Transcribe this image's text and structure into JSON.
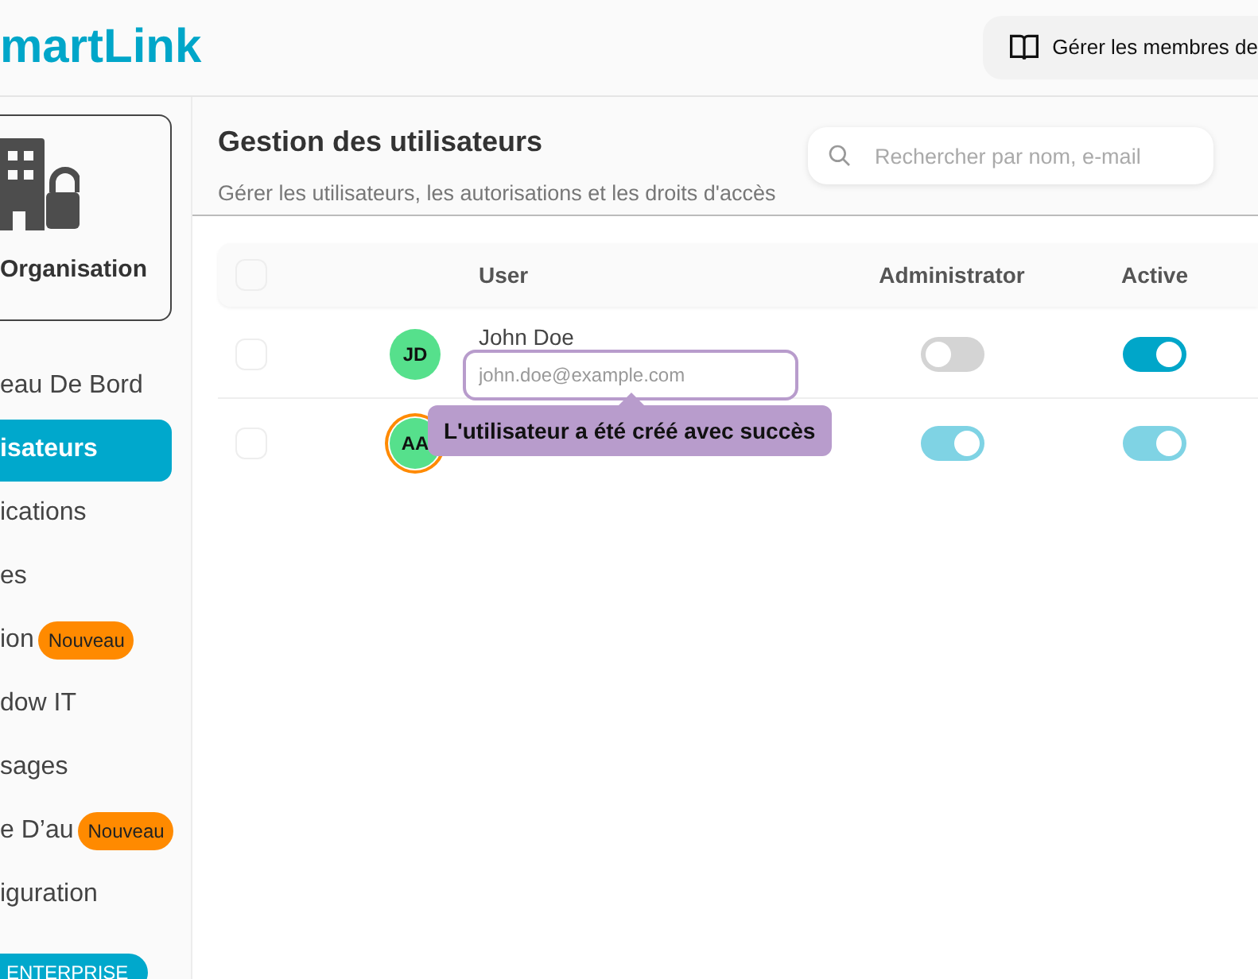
{
  "header": {
    "logo": "martLink",
    "members_button": "Gérer les membres de"
  },
  "sidebar": {
    "organisation": "Organisation",
    "items": [
      {
        "label": "eau De Bord",
        "selected": false
      },
      {
        "label": "isateurs",
        "selected": true
      },
      {
        "label": "ications",
        "selected": false
      },
      {
        "label": "es",
        "selected": false
      },
      {
        "label": "ion",
        "selected": false,
        "badge": "Nouveau"
      },
      {
        "label": "dow IT",
        "selected": false
      },
      {
        "label": "sages",
        "selected": false
      },
      {
        "label": "e D’au",
        "selected": false,
        "badge": "Nouveau"
      },
      {
        "label": "iguration",
        "selected": false
      }
    ],
    "plan": "ENTERPRISE"
  },
  "page": {
    "title": "Gestion des utilisateurs",
    "subtitle": "Gérer les utilisateurs, les autorisations et les droits d'accès",
    "search": {
      "placeholder": "Rechercher par nom, e-mail"
    }
  },
  "table": {
    "all_selected": false,
    "columns": [
      "User",
      "Administrator",
      "Active"
    ],
    "rows": [
      {
        "initials": "JD",
        "name": "John Doe",
        "selected": false,
        "highlighted": false,
        "admin": false,
        "active": true,
        "disabled": false
      },
      {
        "initials": "AA",
        "selected": false,
        "highlighted": true,
        "admin": true,
        "active": true,
        "disabled": true
      }
    ]
  },
  "email_field": {
    "placeholder": "john.doe@example.com"
  },
  "toast": {
    "message": "L'utilisateur a été créé avec succès"
  }
}
